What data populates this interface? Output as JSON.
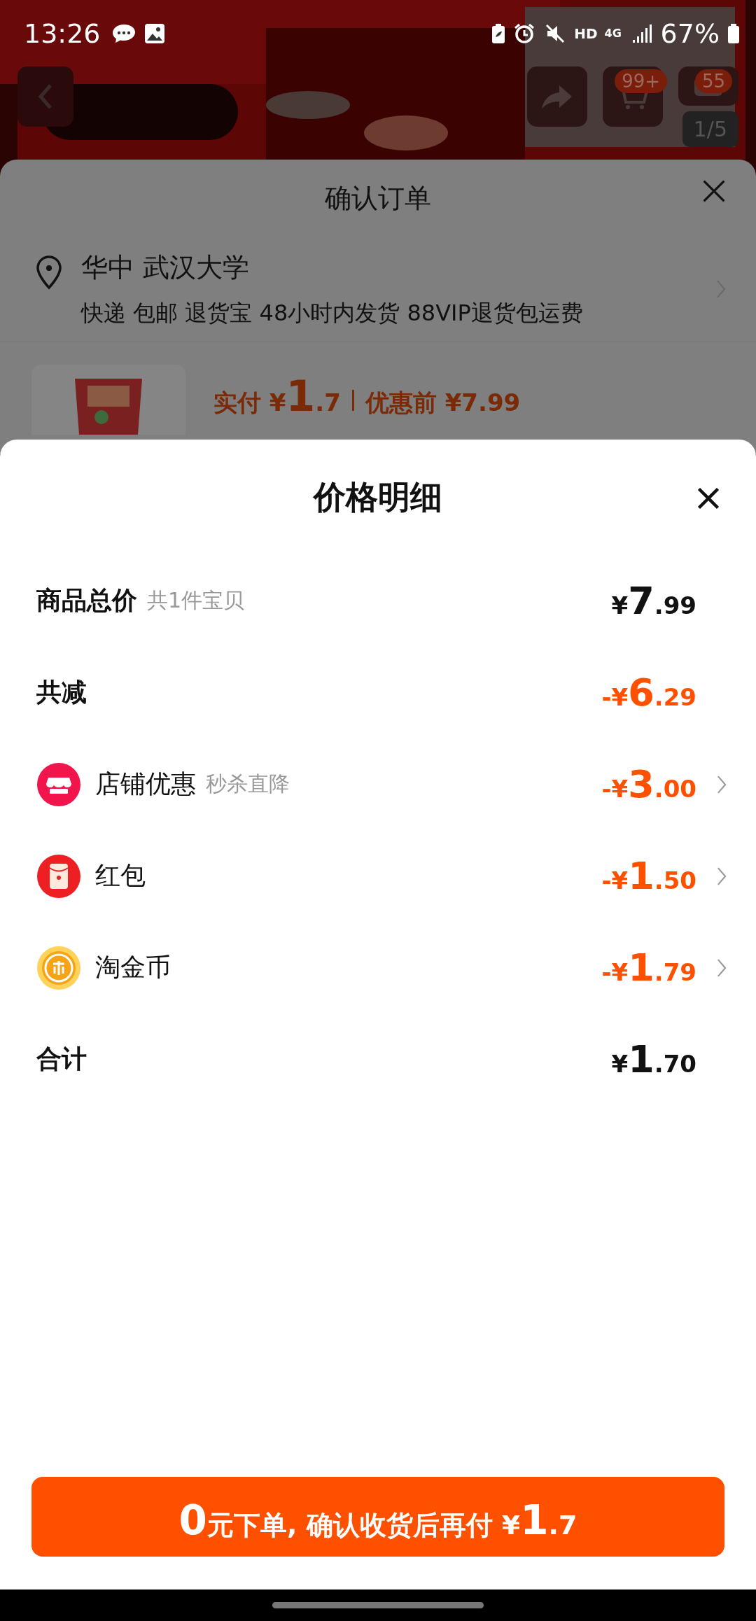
{
  "status_bar": {
    "time": "13:26",
    "hd": "HD",
    "network": "4G",
    "battery": "67%"
  },
  "header": {
    "cart_badge": "99+",
    "message_badge": "55",
    "image_counter": "1/5"
  },
  "order_sheet": {
    "title": "确认订单",
    "address": {
      "name": "华中 武汉大学",
      "details": "快递 包邮 退货宝 48小时内发货 88VIP退货包运费"
    },
    "product": {
      "kind": "picture",
      "paid_label": "实付",
      "paid_price": "¥1.7",
      "original_label": "优惠前",
      "original_price": "¥7.99"
    }
  },
  "price_detail": {
    "title": "价格明细",
    "rows": [
      {
        "kind": "summary",
        "label": "商品总价",
        "note": "共1件宝贝",
        "amount": "¥7.99",
        "highlight": false
      },
      {
        "kind": "summary",
        "label": "共减",
        "amount": "-¥6.29",
        "highlight": true
      },
      {
        "kind": "shop",
        "label": "店铺优惠",
        "note": "秒杀直降",
        "amount": "-¥3.00",
        "highlight": true
      },
      {
        "kind": "packet",
        "label": "红包",
        "amount": "-¥1.50",
        "highlight": true
      },
      {
        "kind": "coin",
        "label": "淘金币",
        "amount": "-¥1.79",
        "highlight": true
      },
      {
        "kind": "summary",
        "label": "合计",
        "amount": "¥1.70",
        "highlight": false
      }
    ]
  },
  "submit_button": "0元下单, 确认收货后再付 ¥1.7"
}
